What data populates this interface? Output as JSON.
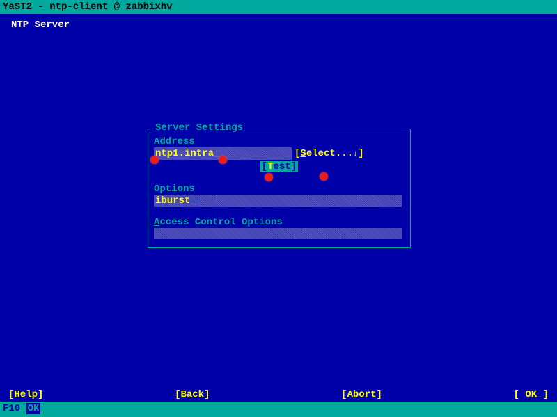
{
  "titlebar": "YaST2 - ntp-client @ zabbixhv",
  "page_title": "NTP Server",
  "panel": {
    "legend": "Server Settings",
    "address_label": "Address",
    "address_value": "ntp1.intra",
    "select_button": "Select...",
    "test_button_open": "[",
    "test_button_hot": "T",
    "test_button_rest": "est]",
    "options_label": "Options",
    "options_value": "iburst",
    "aco_hot": "A",
    "aco_rest": "ccess Control Options",
    "aco_value": ""
  },
  "bottom": {
    "help": "[Help]",
    "back": "[Back]",
    "abort": "[Abort]",
    "ok": "[ OK ]"
  },
  "status": {
    "fkey": "F10",
    "hint": "OK"
  }
}
